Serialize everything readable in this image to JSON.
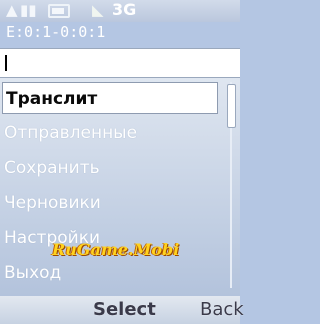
{
  "status": {
    "tag": "3G"
  },
  "path": "E:0:1-0:0:1",
  "menu": {
    "items": [
      {
        "label": "Транслит",
        "selected": true
      },
      {
        "label": "Отправленные",
        "selected": false
      },
      {
        "label": "Сохранить",
        "selected": false
      },
      {
        "label": "Черновики",
        "selected": false
      },
      {
        "label": "Настройки",
        "selected": false
      },
      {
        "label": "Выход",
        "selected": false
      }
    ]
  },
  "watermark": "RuGame.Mobi",
  "softkeys": {
    "left": "Select",
    "right": "Back"
  },
  "colors": {
    "watermark": "#ffd21e",
    "selection_bg": "#ffffff",
    "panel": "#b4c6e3"
  }
}
